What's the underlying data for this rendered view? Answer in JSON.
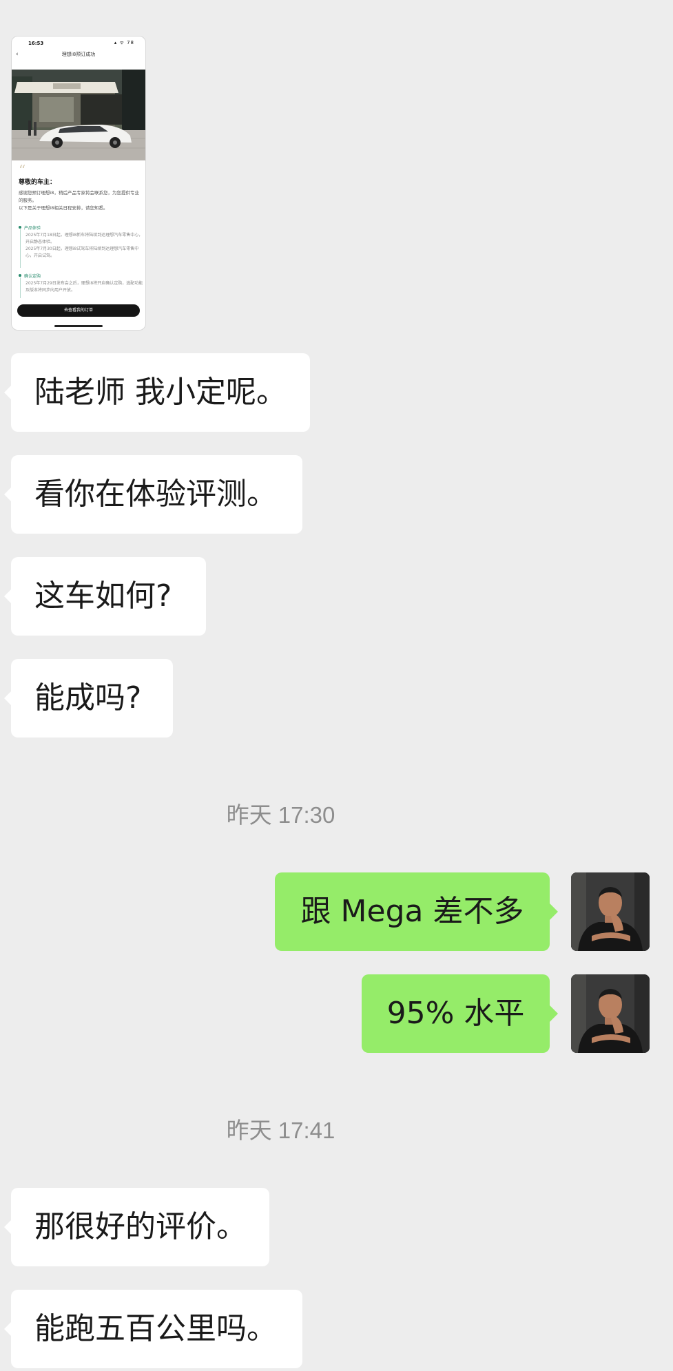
{
  "shared_screenshot": {
    "status_time": "16:53",
    "status_icons": "▴ ᯤ 78",
    "nav_back": "‹",
    "nav_title": "理想i8预订成功",
    "quote_mark": "“",
    "greeting": "尊敬的车主：",
    "intro": "感谢您预订理想i8，稍后产品专家将会联系您，为您提供专业的服务。\n以下是关于理想i8相关日程安排，请您知悉。",
    "section1_title": "产品体验",
    "section1_text": "2025年7月18日起，理想i8新车将陆续到达理想汽车零售中心，开启静态体验。\n2025年7月30日起，理想i8试驾车将陆续到达理想汽车零售中心，开启试驾。",
    "section2_title": "确认定购",
    "section2_text": "2025年7月29日发布会之后，理想i8将开启确认定购，选配功能及版本将同步向用户开放。",
    "cta": "去查看我的订单"
  },
  "messages": [
    {
      "side": "in",
      "text": "陆老师 我小定呢。"
    },
    {
      "side": "in",
      "text": "看你在体验评测。"
    },
    {
      "side": "in",
      "text": "这车如何?"
    },
    {
      "side": "in",
      "text": "能成吗?"
    },
    {
      "type": "time",
      "text": "昨天 17:30"
    },
    {
      "side": "out",
      "text": "跟 Mega 差不多"
    },
    {
      "side": "out",
      "text": "95% 水平"
    },
    {
      "type": "time",
      "text": "昨天 17:41"
    },
    {
      "side": "in",
      "text": "那很好的评价。"
    },
    {
      "side": "in",
      "text": "能跑五百公里吗。"
    }
  ],
  "colors": {
    "background": "#ededed",
    "incoming_bubble": "#ffffff",
    "outgoing_bubble": "#95ec69",
    "timestamp_text": "#8d8d8d"
  }
}
